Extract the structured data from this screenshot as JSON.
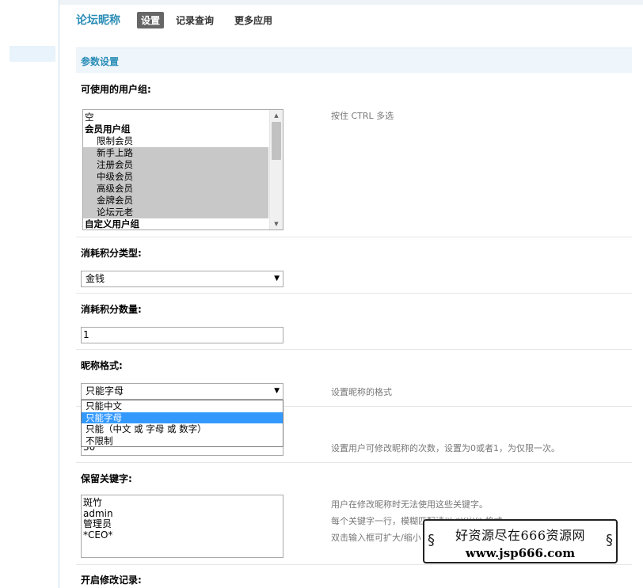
{
  "nav": {
    "title": "论坛昵称",
    "tabs": [
      {
        "label": "设置",
        "active": true
      },
      {
        "label": "记录查询",
        "active": false
      },
      {
        "label": "更多应用",
        "active": false
      }
    ]
  },
  "section": {
    "title": "参数设置"
  },
  "user_groups": {
    "label": "可使用的用户组:",
    "hint": "按住 CTRL 多选",
    "options": [
      {
        "label": "空",
        "type": "item",
        "selected": false
      },
      {
        "label": "会员用户组",
        "type": "group",
        "selected": false
      },
      {
        "label": "限制会员",
        "type": "child",
        "selected": false
      },
      {
        "label": "新手上路",
        "type": "child",
        "selected": true
      },
      {
        "label": "注册会员",
        "type": "child",
        "selected": true
      },
      {
        "label": "中级会员",
        "type": "child",
        "selected": true
      },
      {
        "label": "高级会员",
        "type": "child",
        "selected": true
      },
      {
        "label": "金牌会员",
        "type": "child",
        "selected": true
      },
      {
        "label": "论坛元老",
        "type": "child",
        "selected": true
      },
      {
        "label": "自定义用户组",
        "type": "group",
        "selected": false
      }
    ]
  },
  "credit_type": {
    "label": "消耗积分类型:",
    "value": "金钱"
  },
  "credit_amount": {
    "label": "消耗积分数量:",
    "value": "1"
  },
  "nickname_format": {
    "label": "昵称格式:",
    "value": "只能字母",
    "hint": "设置昵称的格式",
    "options": [
      {
        "label": "只能中文",
        "highlighted": false
      },
      {
        "label": "只能字母",
        "highlighted": true
      },
      {
        "label": "只能（中文 或 字母 或 数字）",
        "highlighted": false
      },
      {
        "label": "不限制",
        "highlighted": false
      }
    ]
  },
  "modify_times": {
    "value": "30",
    "hint": "设置用户可修改昵称的次数，设置为0或者1，为仅限一次。"
  },
  "reserved_keywords": {
    "label": "保留关键字:",
    "lines": [
      "斑竹",
      "admin",
      "管理员",
      "*CEO*"
    ],
    "hints": [
      "用户在修改昵称时无法使用这些关键字。",
      "每个关键字一行，模糊匹配请以 *XXX* 格式",
      "双击输入框可扩大/缩小"
    ]
  },
  "modify_record": {
    "label": "开启修改记录:"
  },
  "watermark": {
    "line1": "好资源尽在666资源网",
    "line2": "www.jsp666.com"
  },
  "colors": {
    "accent": "#2a8db6",
    "dropdown_highlight": "#3399ff",
    "selected_item": "#c8c8c8"
  },
  "icons": {
    "scroll_up": "triangle-up",
    "scroll_down": "triangle-down",
    "select_caret": "triangle-down"
  }
}
